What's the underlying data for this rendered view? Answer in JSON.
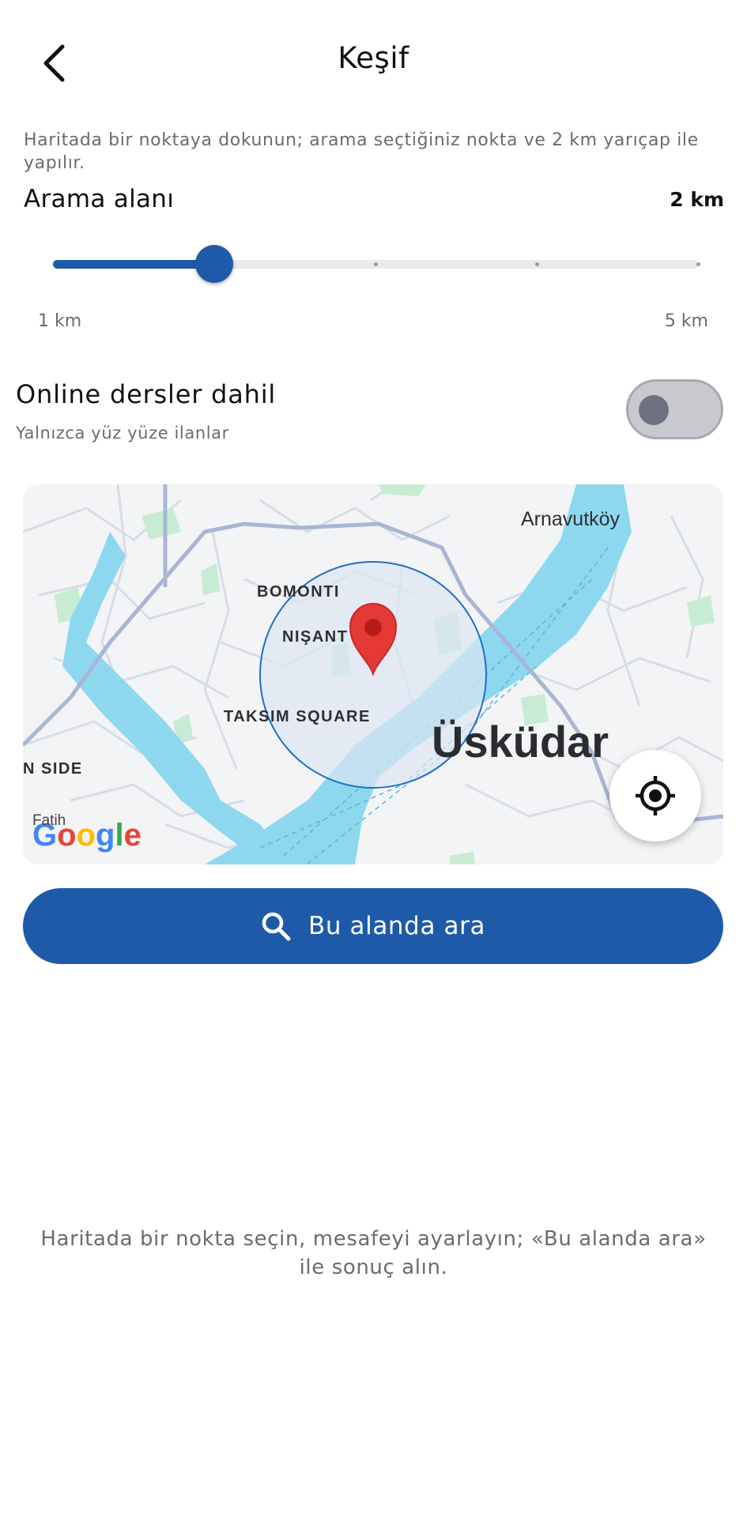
{
  "header": {
    "title": "Keşif",
    "back_icon": "chevron-left-icon"
  },
  "hint": "Haritada bir noktaya dokunun; arama seçtiğiniz nokta ve 2 km yarıçap ile yapılır.",
  "search_area": {
    "label": "Arama alanı",
    "value_text": "2 km",
    "min_label": "1 km",
    "max_label": "5 km",
    "value_km": 2,
    "min_km": 1,
    "max_km": 5
  },
  "online_toggle": {
    "label": "Online dersler dahil",
    "sublabel": "Yalnızca yüz yüze ilanlar",
    "on": false
  },
  "map": {
    "labels": {
      "arnavutkoy": "Arnavutköy",
      "bomonti": "BOMONTI",
      "nisantasi": "NIŞANT",
      "taksim": "TAKSIM SQUARE",
      "uskudar": "Üsküdar",
      "side": "N SIDE",
      "fatih": "Fatih"
    },
    "logo": "Google",
    "radius_km": 2,
    "pin_icon": "map-pin-icon",
    "locate_icon": "crosshair-icon",
    "colors": {
      "water": "#8ed8ef",
      "park": "#c7ecd3",
      "road": "#a9b6d3",
      "circle_fill": "#dbe6f3",
      "circle_stroke": "#1f6fc5",
      "pin": "#e53935"
    }
  },
  "search_button": {
    "label": "Bu alanda ara",
    "icon": "search-icon"
  },
  "empty_message": "Haritada bir nokta seçin, mesafeyi ayarlayın; «Bu alanda ara» ile sonuç alın.",
  "colors": {
    "accent": "#1f5aa8",
    "secondary_text": "#6b6b70"
  }
}
